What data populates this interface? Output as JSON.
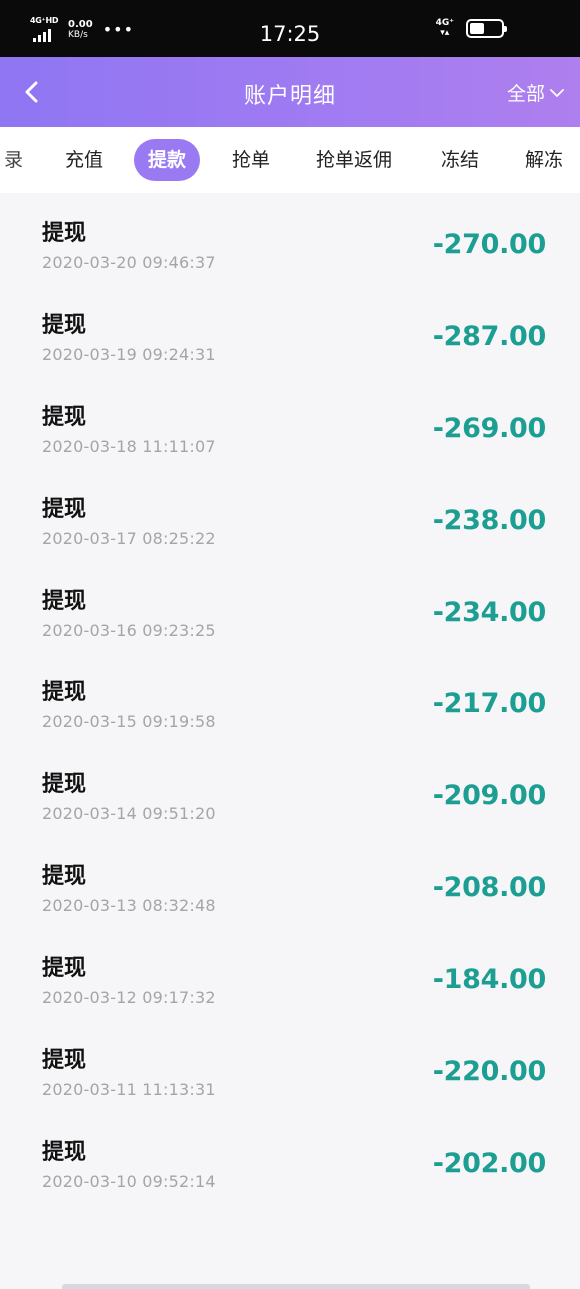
{
  "status_bar": {
    "network_left": "4G⁺HD",
    "speed_value": "0.00",
    "speed_unit": "KB/s",
    "dots": "•••",
    "time": "17:25",
    "network_right": "4G⁺",
    "network_arrows": "▾▴",
    "battery_level": 0.45
  },
  "nav": {
    "back_icon": "chevron-left-icon",
    "title": "账户明细",
    "filter_label": "全部",
    "filter_icon": "chevron-down-icon"
  },
  "tabs": [
    {
      "label": "录",
      "active": false,
      "partial": true
    },
    {
      "label": "充值",
      "active": false
    },
    {
      "label": "提款",
      "active": true
    },
    {
      "label": "抢单",
      "active": false
    },
    {
      "label": "抢单返佣",
      "active": false
    },
    {
      "label": "冻结",
      "active": false
    },
    {
      "label": "解冻",
      "active": false
    }
  ],
  "records": [
    {
      "type": "提现",
      "time": "2020-03-20 09:46:37",
      "amount": "-270.00"
    },
    {
      "type": "提现",
      "time": "2020-03-19 09:24:31",
      "amount": "-287.00"
    },
    {
      "type": "提现",
      "time": "2020-03-18 11:11:07",
      "amount": "-269.00"
    },
    {
      "type": "提现",
      "time": "2020-03-17 08:25:22",
      "amount": "-238.00"
    },
    {
      "type": "提现",
      "time": "2020-03-16 09:23:25",
      "amount": "-234.00"
    },
    {
      "type": "提现",
      "time": "2020-03-15 09:19:58",
      "amount": "-217.00"
    },
    {
      "type": "提现",
      "time": "2020-03-14 09:51:20",
      "amount": "-209.00"
    },
    {
      "type": "提现",
      "time": "2020-03-13 08:32:48",
      "amount": "-208.00"
    },
    {
      "type": "提现",
      "time": "2020-03-12 09:17:32",
      "amount": "-184.00"
    },
    {
      "type": "提现",
      "time": "2020-03-11 11:13:31",
      "amount": "-220.00"
    },
    {
      "type": "提现",
      "time": "2020-03-10 09:52:14",
      "amount": "-202.00"
    }
  ],
  "colors": {
    "nav_gradient_start": "#8f76f3",
    "nav_gradient_end": "#ae7fee",
    "active_tab": "#9a7af3",
    "amount": "#1d9e93",
    "time_text": "#a4a4aa"
  }
}
